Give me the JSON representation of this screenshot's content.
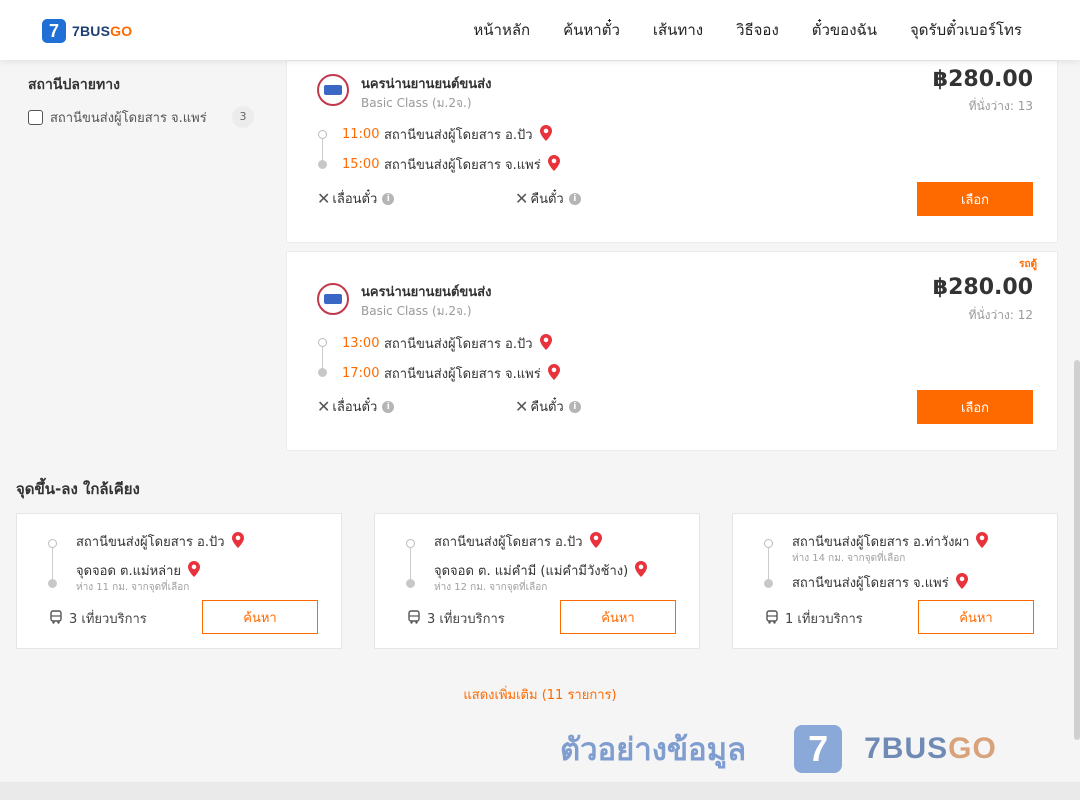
{
  "brand": {
    "mark": "7",
    "name_a": "7BUS",
    "name_b": "GO"
  },
  "nav": [
    "หน้าหลัก",
    "ค้นหาตั๋ว",
    "เส้นทาง",
    "วิธีจอง",
    "ตั๋วของฉัน",
    "จุดรับตั๋วเบอร์โทร"
  ],
  "filter": {
    "title": "สถานีปลายทาง",
    "items": [
      {
        "label": "สถานีขนส่งผู้โดยสาร จ.แพร่",
        "count": "3"
      }
    ]
  },
  "trips": [
    {
      "operator": "นครน่านยานยนต์ขนส่ง",
      "class": "Basic Class (ม.2จ.)",
      "price": "฿280.00",
      "seats": "ที่นั่งว่าง: 13",
      "badge": "",
      "depart_time": "11:00",
      "depart_station": "สถานีขนส่งผู้โดยสาร อ.ปัว",
      "arrive_time": "15:00",
      "arrive_station": "สถานีขนส่งผู้โดยสาร จ.แพร่",
      "postpone": "เลื่อนตั๋ว",
      "refund": "คืนตั๋ว",
      "button": "เลือก"
    },
    {
      "operator": "นครน่านยานยนต์ขนส่ง",
      "class": "Basic Class (ม.2จ.)",
      "price": "฿280.00",
      "seats": "ที่นั่งว่าง: 12",
      "badge": "รถตู้",
      "depart_time": "13:00",
      "depart_station": "สถานีขนส่งผู้โดยสาร อ.ปัว",
      "arrive_time": "17:00",
      "arrive_station": "สถานีขนส่งผู้โดยสาร จ.แพร่",
      "postpone": "เลื่อนตั๋ว",
      "refund": "คืนตั๋ว",
      "button": "เลือก"
    }
  ],
  "nearby": {
    "title": "จุดขึ้น-ลง ใกล้เคียง",
    "cards": [
      {
        "from": "สถานีขนส่งผู้โดยสาร อ.ปัว",
        "from_dist": "",
        "to": "จุดจอด ต.แม่หล่าย",
        "to_dist": "ห่าง 11 กม. จากจุดที่เลือก",
        "trips": "3 เที่ยวบริการ",
        "button": "ค้นหา"
      },
      {
        "from": "สถานีขนส่งผู้โดยสาร อ.ปัว",
        "from_dist": "",
        "to": "จุดจอด ต. แม่คำมี (แม่คำมีวังช้าง)",
        "to_dist": "ห่าง 12 กม. จากจุดที่เลือก",
        "trips": "3 เที่ยวบริการ",
        "button": "ค้นหา"
      },
      {
        "from": "สถานีขนส่งผู้โดยสาร อ.ท่าวังผา",
        "from_dist": "ห่าง 14 กม. จากจุดที่เลือก",
        "to": "สถานีขนส่งผู้โดยสาร จ.แพร่",
        "to_dist": "",
        "trips": "1 เที่ยวบริการ",
        "button": "ค้นหา"
      }
    ]
  },
  "more_link": "แสดงเพิ่มเติม (11 รายการ)",
  "watermark": {
    "text": "ตัวอย่างข้อมูล",
    "mark": "7",
    "brand_a": "7BUS",
    "brand_b": "GO"
  },
  "colors": {
    "accent": "#ff6a00",
    "brand_blue": "#1f6fd6",
    "pin_red": "#e8323c"
  }
}
